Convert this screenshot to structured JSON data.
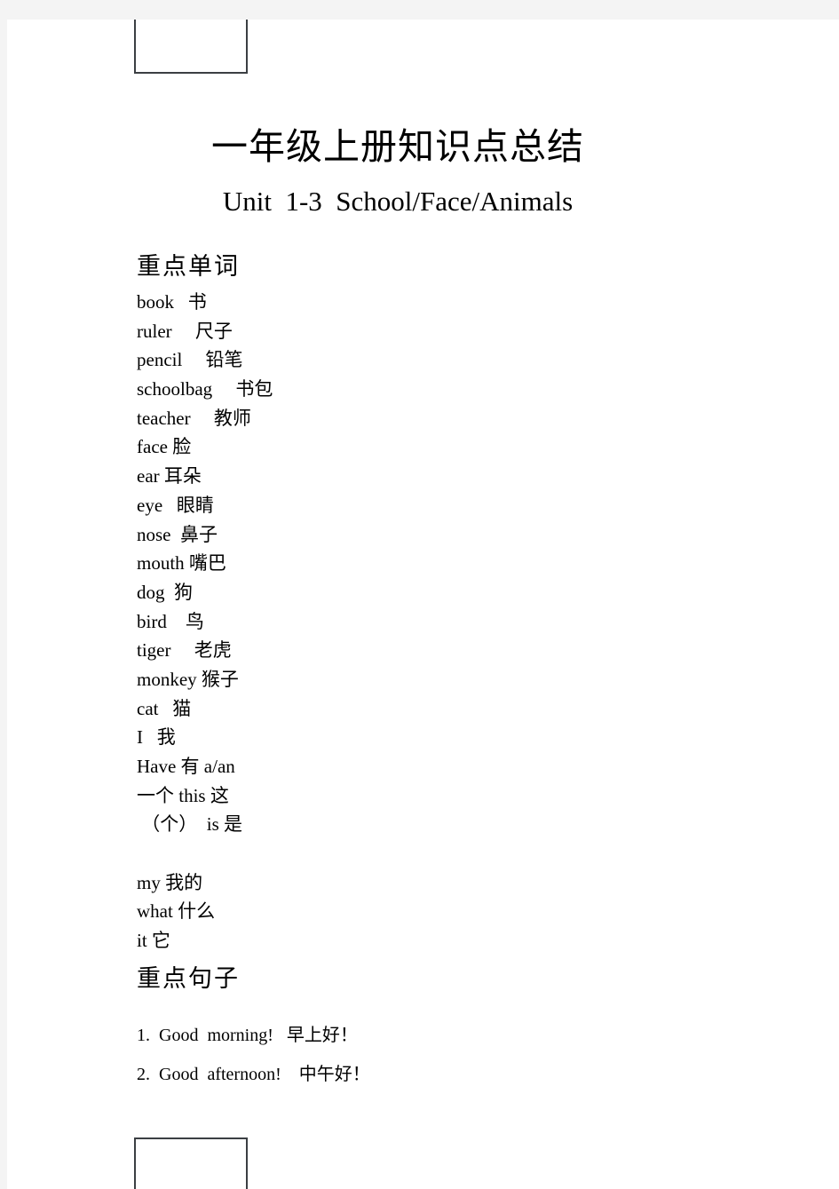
{
  "document": {
    "title": "一年级上册知识点总结",
    "subtitle": "Unit  1-3  School/Face/Animals"
  },
  "sections": {
    "words": {
      "heading": "重点单词",
      "rows": [
        "book   书",
        "ruler     尺子",
        "pencil     铅笔",
        "schoolbag     书包",
        "teacher     教师",
        "face 脸",
        "ear 耳朵",
        "eye   眼睛",
        "nose  鼻子",
        "mouth 嘴巴",
        "dog  狗",
        "bird    鸟",
        "tiger     老虎",
        "monkey 猴子",
        "cat   猫",
        "I   我",
        "Have 有 a/an",
        "一个 this 这",
        " （个）  is 是",
        "",
        "my 我的",
        "what 什么",
        "it 它"
      ]
    },
    "sentences": {
      "heading": "重点句子",
      "rows": [
        "1.  Good  morning!   早上好！",
        "2.  Good  afternoon!    中午好！"
      ]
    }
  },
  "frames": {
    "header_box_label": "",
    "footer_box_label": ""
  },
  "colors": {
    "page_background": "#ffffff",
    "canvas_background": "#f4f4f4",
    "text": "#000000",
    "frame_border": "#3b3f43"
  }
}
